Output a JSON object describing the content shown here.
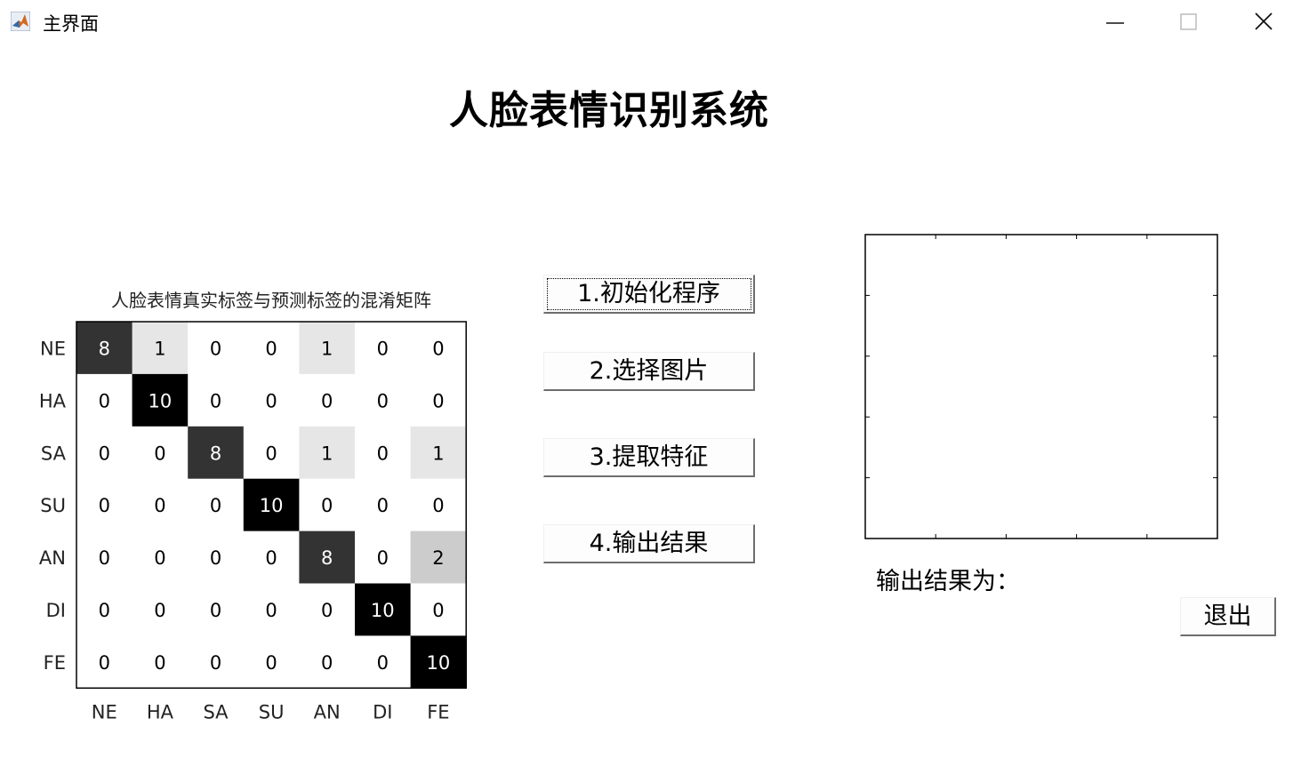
{
  "window": {
    "title": "主界面",
    "controls": [
      "minimize-icon",
      "maximize-icon",
      "close-icon"
    ]
  },
  "main_title": "人脸表情识别系统",
  "confusion_matrix": {
    "title": "人脸表情真实标签与预测标签的混淆矩阵"
  },
  "chart_data": {
    "type": "heatmap",
    "title": "人脸表情真实标签与预测标签的混淆矩阵",
    "row_labels": [
      "NE",
      "HA",
      "SA",
      "SU",
      "AN",
      "DI",
      "FE"
    ],
    "col_labels": [
      "NE",
      "HA",
      "SA",
      "SU",
      "AN",
      "DI",
      "FE"
    ],
    "values": [
      [
        8,
        1,
        0,
        0,
        1,
        0,
        0
      ],
      [
        0,
        10,
        0,
        0,
        0,
        0,
        0
      ],
      [
        0,
        0,
        8,
        0,
        1,
        0,
        1
      ],
      [
        0,
        0,
        0,
        10,
        0,
        0,
        0
      ],
      [
        0,
        0,
        0,
        0,
        8,
        0,
        2
      ],
      [
        0,
        0,
        0,
        0,
        0,
        10,
        0
      ],
      [
        0,
        0,
        0,
        0,
        0,
        0,
        10
      ]
    ],
    "colormap": "gray-inverted",
    "max_value": 10
  },
  "buttons": {
    "init": "1.初始化程序",
    "select": "2.选择图片",
    "extract": "3.提取特征",
    "output": "4.输出结果"
  },
  "result_label": "输出结果为：",
  "exit_label": "退出"
}
